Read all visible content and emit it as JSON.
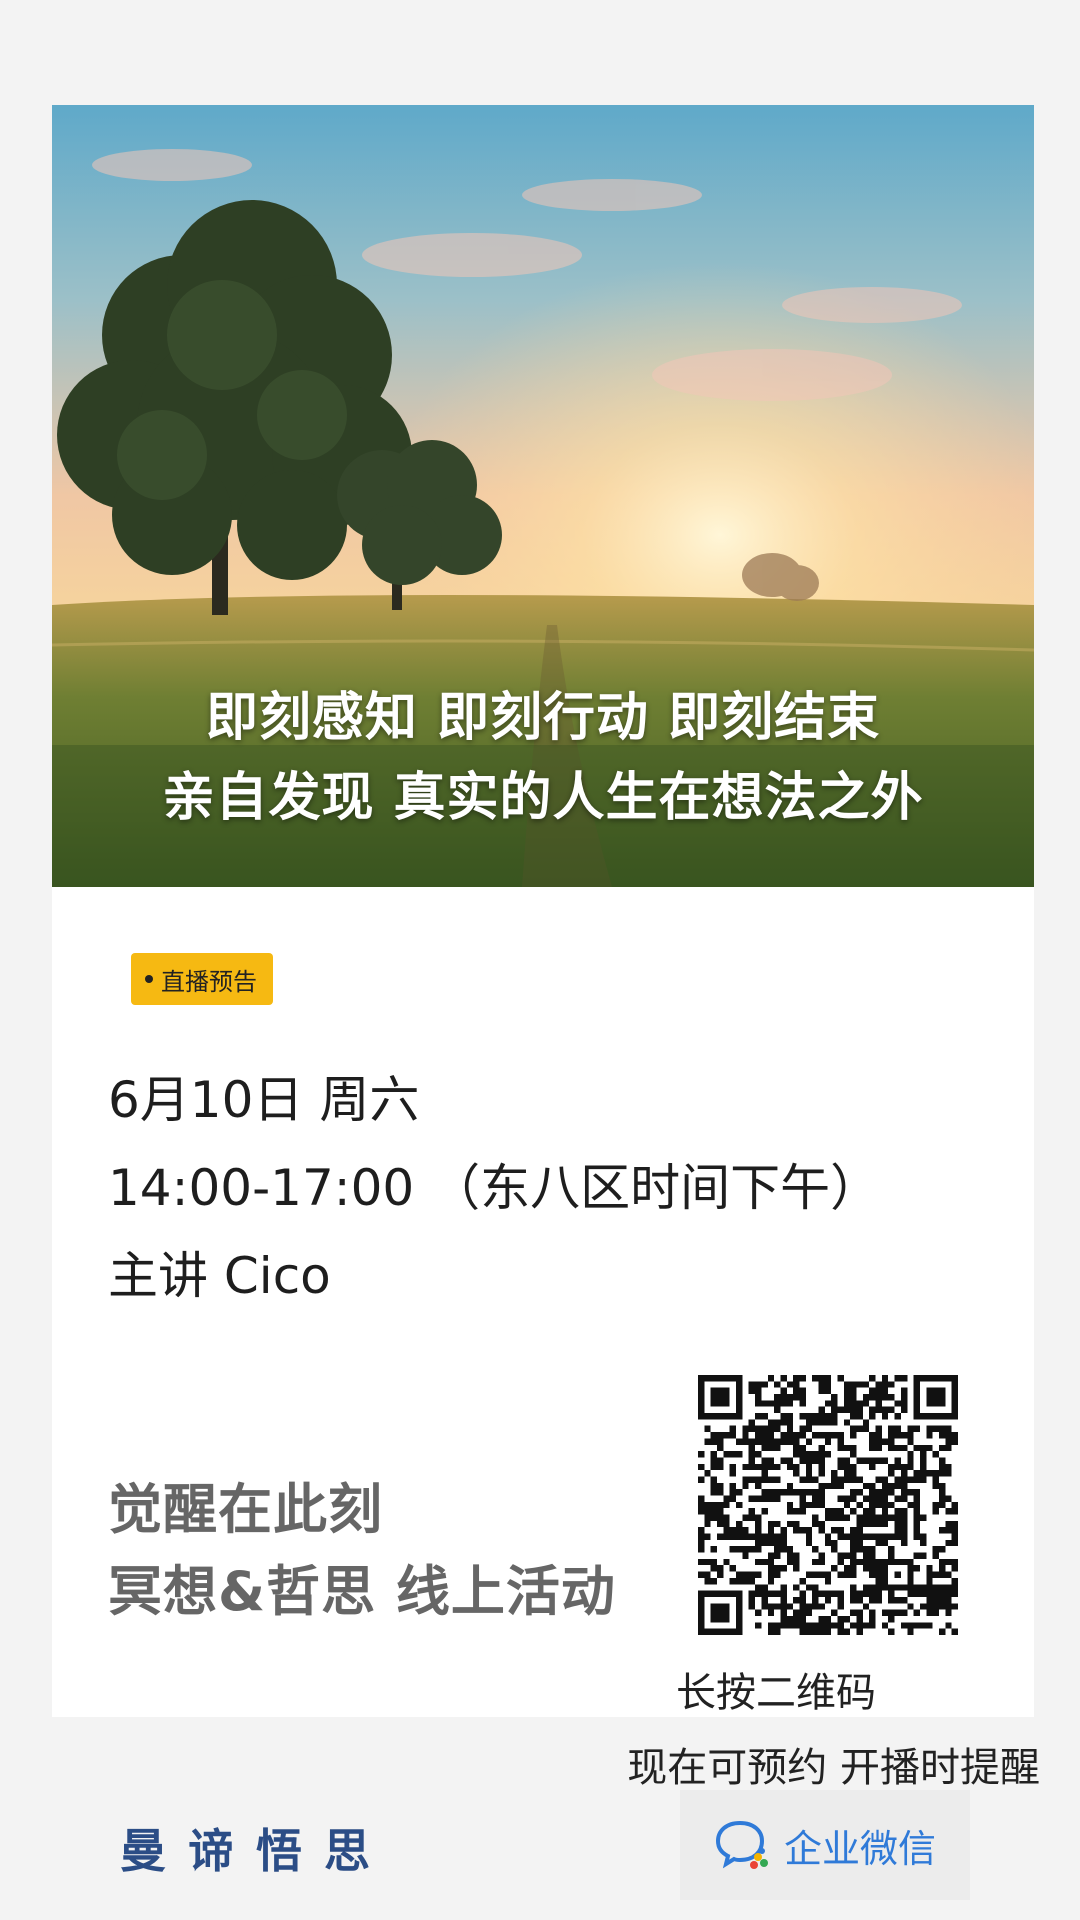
{
  "hero": {
    "line1": "即刻感知  即刻行动  即刻结束",
    "line2": "亲自发现  真实的人生在想法之外"
  },
  "badge": {
    "label": "直播预告"
  },
  "event": {
    "date": "6月10日 周六",
    "time": "14:00-17:00 （东八区时间下午）",
    "speaker": "主讲 Cico"
  },
  "slogan": {
    "line1": "觉醒在此刻",
    "line2": "冥想&哲思  线上活动"
  },
  "qr": {
    "caption": "长按二维码"
  },
  "footer": {
    "reserve": "现在可预约 开播时提醒",
    "brand": "曼谛悟思",
    "wecom_label": "企业微信"
  },
  "colors": {
    "badge": "#f6b912",
    "brand": "#2b4d86",
    "wecom": "#2f7ad8",
    "background": "#f3f3f3"
  }
}
